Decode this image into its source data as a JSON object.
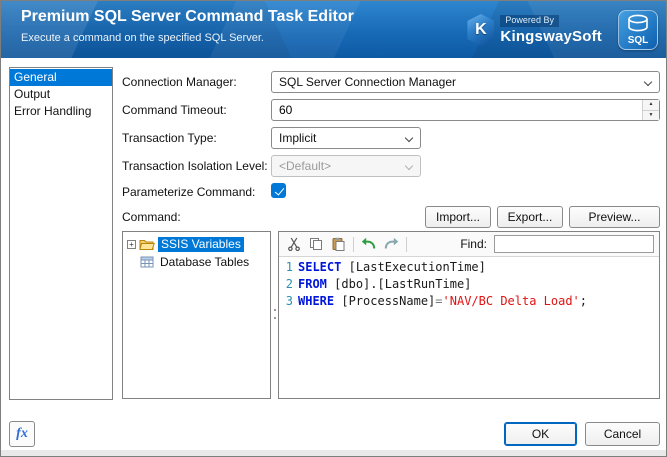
{
  "colors": {
    "accent": "#0078d7",
    "keyword": "#0016d9",
    "string": "#e01313",
    "identifier": "#1a1a1a",
    "line_number": "#2b91af"
  },
  "header": {
    "title": "Premium SQL Server Command Task Editor",
    "subtitle": "Execute a command on the specified SQL Server.",
    "powered_by": "Powered By",
    "brand": "KingswaySoft",
    "brand_initial": "K",
    "sql_badge": "SQL"
  },
  "nav": {
    "items": [
      {
        "label": "General",
        "selected": true
      },
      {
        "label": "Output",
        "selected": false
      },
      {
        "label": "Error Handling",
        "selected": false
      }
    ]
  },
  "form": {
    "connection_manager_label": "Connection Manager:",
    "connection_manager_value": "SQL Server Connection Manager",
    "command_timeout_label": "Command Timeout:",
    "command_timeout_value": "60",
    "transaction_type_label": "Transaction Type:",
    "transaction_type_value": "Implicit",
    "transaction_isolation_label": "Transaction Isolation Level:",
    "transaction_isolation_value": "<Default>",
    "parameterize_label": "Parameterize Command:",
    "parameterize_checked": true,
    "command_label": "Command:"
  },
  "toolbar_buttons": {
    "import": "Import...",
    "export": "Export...",
    "preview": "Preview..."
  },
  "tree": {
    "items": [
      {
        "label": "SSIS Variables",
        "selected": true
      },
      {
        "label": "Database Tables",
        "selected": false
      }
    ]
  },
  "editor": {
    "find_label": "Find:",
    "find_value": "",
    "lines": [
      {
        "num": "1",
        "segments": [
          {
            "t": "SELECT",
            "c": "kw"
          },
          {
            "t": " ",
            "c": "pl"
          },
          {
            "t": "[LastExecutionTime]",
            "c": "id"
          }
        ]
      },
      {
        "num": "2",
        "segments": [
          {
            "t": "FROM",
            "c": "kw"
          },
          {
            "t": " ",
            "c": "pl"
          },
          {
            "t": "[dbo].[LastRunTime]",
            "c": "id"
          }
        ]
      },
      {
        "num": "3",
        "segments": [
          {
            "t": "WHERE",
            "c": "kw"
          },
          {
            "t": " ",
            "c": "pl"
          },
          {
            "t": "[ProcessName]",
            "c": "id"
          },
          {
            "t": "=",
            "c": "op"
          },
          {
            "t": "'NAV/BC Delta Load'",
            "c": "str"
          },
          {
            "t": ";",
            "c": "pl"
          }
        ]
      }
    ]
  },
  "footer": {
    "fx": "fx",
    "ok": "OK",
    "cancel": "Cancel"
  }
}
